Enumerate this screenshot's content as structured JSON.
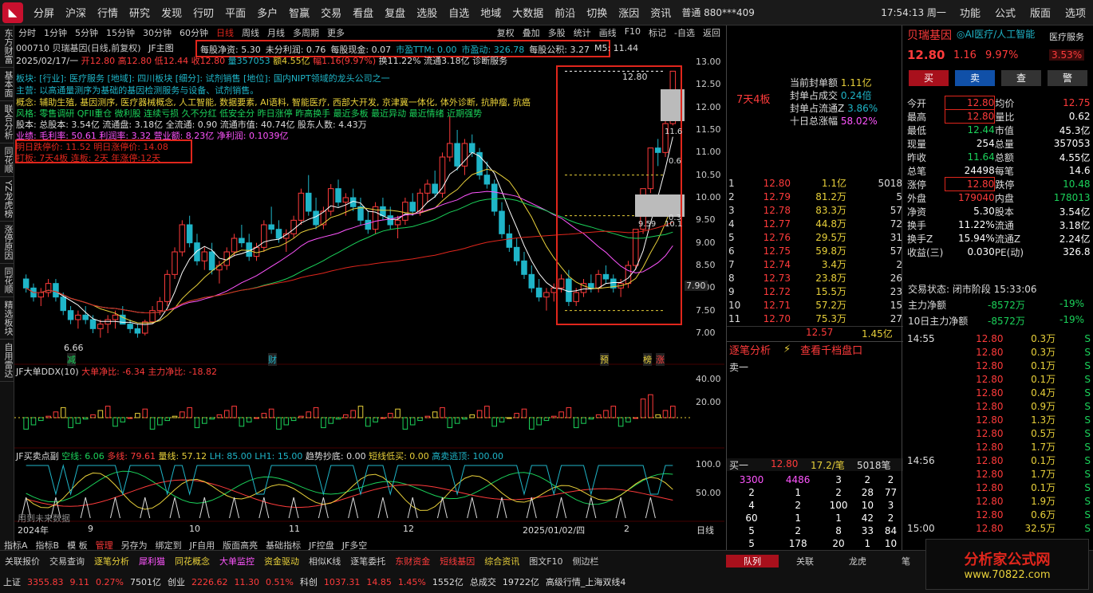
{
  "topbar": {
    "logo": "◣",
    "menu": [
      "分屏",
      "沪深",
      "行情",
      "研究",
      "发现",
      "行叨",
      "平面",
      "多户",
      "智赢",
      "交易",
      "看盘",
      "复盘",
      "选股",
      "自选",
      "地域",
      "大数据",
      "前沿",
      "切换",
      "涨因",
      "资讯"
    ],
    "account": "普通 880***409",
    "clock": "17:54:13 周一",
    "right_menu": [
      "功能",
      "公式",
      "版面",
      "选项"
    ]
  },
  "left_rail": [
    "东方财富",
    "基本面",
    "联合分析",
    "同花顺",
    "YZ龙虎榜",
    "涨停原因",
    "同花顺",
    "精选板块",
    "自用雷达"
  ],
  "toolbar": {
    "periods": [
      "分时",
      "1分钟",
      "5分钟",
      "15分钟",
      "30分钟",
      "60分钟",
      "日线",
      "周线",
      "月线",
      "多周期",
      "更多"
    ],
    "right": [
      "复权",
      "叠加",
      "多股",
      "统计",
      "画线",
      "F10",
      "标记",
      "-自选",
      "返回"
    ]
  },
  "chart_header": {
    "code_title": "000710 贝瑞基因(日线,前复权)",
    "indicator": "JF主图",
    "date": "2025/02/17/一",
    "open": "开12.80",
    "high": "高12.80",
    "low": "低12.44",
    "close": "收12.80",
    "vol": "量357053",
    "amount": "额4.55亿",
    "change": "幅1.16(9.97%)",
    "turnover": "换11.22%",
    "float": "流通3.18亿",
    "tag": "诊断服务"
  },
  "fin": {
    "a": "每股净资: 5.30",
    "b": "未分利润: 0.76",
    "c": "每股现金: 0.07",
    "d": "市盈TTM: 0.00",
    "e": "市盈动: 326.78",
    "f": "每股公积: 3.27",
    "g": "M5: 11.44"
  },
  "info": {
    "l1": "板块: [行业]: 医疗服务 [地域]: 四川板块 [细分]: 试剂销售 [地位]: 国内NIPT领域的龙头公司之一",
    "l2": "主营: 以高通量测序为基础的基因检测服务与设备、试剂销售。",
    "l3": "概念: 辅助生殖, 基因测序, 医疗器械概念, 人工智能, 数据要素, AI语料, 智能医疗, 西部大开发, 京津冀一体化, 体外诊断, 抗肿瘤, 抗癌",
    "l4": "风格: 零售调研 QFII重仓 微利股 连续亏损 久不分红 低安全分 昨日涨停 昨高换手 最近多板 最近异动 最近情绪 近期强势",
    "l5": "股本: 总股本: 3.54亿 流通盘: 3.18亿 全流通: 0.90 流通市值: 40.74亿 股东人数: 4.43万",
    "l6": "业绩: 毛利率: 50.61 利润率: 3.32 营业额: 8.23亿 净利润: 0.1039亿",
    "l7": "明日跌停价: 11.52 明日涨停价: 14.08",
    "l8": "打板: 7天4板 连板: 2天 年涨停:12天"
  },
  "chart_data": {
    "type": "candlestick",
    "yaxis": [
      "13.00",
      "12.50",
      "12.00",
      "11.50",
      "11.00",
      "10.50",
      "10.00",
      "9.50",
      "9.00",
      "8.50",
      "8.00",
      "7.90",
      "7.50",
      "7.00"
    ],
    "ylim": [
      7.0,
      13.0
    ],
    "xlabels": [
      "2024年",
      "9",
      "10",
      "11",
      "12",
      "2025/01/02/四",
      "2",
      "日线"
    ],
    "low_mark": "6.66",
    "last_price": "12.80",
    "marks": [
      "减",
      "财",
      "预",
      "榜",
      "涨"
    ],
    "panel_tags": [
      "11.6",
      "10.1",
      "9.59",
      "0.6",
      "0.3"
    ],
    "board_label": "7天4板",
    "sealing": {
      "title1": "当前封单额",
      "v1": "1.11亿",
      "title2": "封单占成交",
      "v2": "0.24倍",
      "title3": "封单占流通Z",
      "v3": "3.86%",
      "title4": "十日总涨幅",
      "v4": "58.02%"
    },
    "ohlc": [
      [
        8.2,
        8.3,
        7.9,
        8.0
      ],
      [
        8.0,
        8.1,
        7.7,
        7.8
      ],
      [
        7.8,
        8.0,
        7.6,
        7.9
      ],
      [
        7.9,
        8.2,
        7.8,
        8.1
      ],
      [
        8.1,
        8.2,
        7.7,
        7.8
      ],
      [
        7.8,
        7.9,
        7.4,
        7.5
      ],
      [
        7.5,
        7.6,
        7.2,
        7.3
      ],
      [
        7.3,
        7.5,
        7.1,
        7.4
      ],
      [
        7.4,
        7.6,
        7.2,
        7.3
      ],
      [
        7.3,
        7.4,
        7.0,
        7.1
      ],
      [
        7.1,
        7.3,
        6.9,
        7.2
      ],
      [
        7.2,
        7.4,
        7.0,
        7.3
      ],
      [
        7.3,
        7.5,
        7.1,
        7.4
      ],
      [
        7.4,
        7.6,
        7.2,
        7.2
      ],
      [
        7.2,
        7.3,
        7.0,
        7.1
      ],
      [
        7.1,
        7.2,
        6.9,
        7.0
      ],
      [
        7.0,
        7.3,
        6.95,
        7.25
      ],
      [
        7.25,
        7.6,
        7.2,
        7.5
      ],
      [
        7.5,
        7.8,
        7.4,
        7.7
      ],
      [
        7.7,
        8.4,
        7.6,
        8.3
      ],
      [
        8.3,
        8.9,
        8.2,
        8.8
      ],
      [
        8.8,
        9.5,
        8.7,
        9.4
      ],
      [
        9.4,
        9.6,
        8.9,
        9.0
      ],
      [
        9.0,
        9.2,
        8.5,
        8.6
      ],
      [
        8.6,
        8.9,
        8.4,
        8.8
      ],
      [
        8.8,
        9.0,
        8.3,
        8.4
      ],
      [
        8.4,
        8.6,
        8.1,
        8.5
      ],
      [
        8.5,
        8.9,
        8.4,
        8.8
      ],
      [
        8.8,
        9.2,
        8.7,
        9.1
      ],
      [
        9.1,
        9.4,
        8.9,
        9.0
      ],
      [
        9.0,
        9.2,
        8.6,
        8.7
      ],
      [
        8.7,
        9.0,
        8.6,
        8.9
      ],
      [
        8.9,
        9.5,
        8.8,
        9.4
      ],
      [
        9.4,
        9.8,
        9.2,
        9.3
      ],
      [
        9.3,
        9.5,
        9.0,
        9.1
      ],
      [
        9.1,
        9.3,
        8.8,
        9.2
      ],
      [
        9.2,
        9.6,
        9.1,
        9.5
      ],
      [
        9.5,
        10.2,
        9.4,
        10.1
      ],
      [
        10.1,
        10.5,
        9.6,
        9.7
      ],
      [
        9.7,
        10.0,
        9.3,
        9.4
      ],
      [
        9.4,
        9.8,
        9.3,
        9.7
      ],
      [
        9.7,
        10.3,
        9.6,
        10.2
      ],
      [
        10.2,
        10.4,
        9.8,
        9.9
      ],
      [
        9.9,
        10.1,
        9.6,
        10.0
      ],
      [
        10.0,
        10.2,
        9.7,
        9.8
      ],
      [
        9.8,
        10.0,
        9.4,
        9.5
      ],
      [
        9.5,
        9.7,
        9.2,
        9.3
      ],
      [
        9.3,
        9.9,
        9.2,
        9.8
      ],
      [
        9.8,
        10.0,
        9.5,
        9.6
      ],
      [
        9.6,
        9.8,
        9.3,
        9.4
      ],
      [
        9.4,
        9.6,
        9.1,
        9.5
      ],
      [
        9.5,
        10.0,
        9.4,
        9.9
      ],
      [
        9.9,
        10.1,
        9.6,
        9.7
      ],
      [
        9.7,
        10.2,
        9.6,
        10.1
      ],
      [
        10.1,
        10.4,
        9.9,
        10.3
      ],
      [
        10.3,
        10.6,
        10.0,
        10.1
      ],
      [
        10.1,
        11.0,
        10.0,
        10.9
      ],
      [
        10.9,
        11.8,
        10.8,
        11.2
      ],
      [
        11.2,
        11.5,
        10.6,
        10.7
      ],
      [
        10.7,
        11.3,
        10.5,
        11.2
      ],
      [
        11.2,
        11.4,
        10.9,
        11.0
      ],
      [
        11.0,
        11.1,
        10.4,
        10.5
      ],
      [
        10.5,
        10.8,
        10.2,
        10.3
      ],
      [
        10.3,
        10.4,
        9.6,
        9.7
      ],
      [
        9.7,
        9.9,
        9.1,
        9.2
      ],
      [
        9.2,
        9.4,
        8.8,
        8.9
      ],
      [
        8.9,
        9.1,
        8.5,
        8.6
      ],
      [
        8.6,
        8.8,
        8.2,
        8.3
      ],
      [
        8.3,
        8.5,
        7.9,
        8.0
      ],
      [
        8.0,
        8.2,
        7.7,
        7.8
      ],
      [
        7.8,
        8.0,
        7.5,
        7.9
      ],
      [
        7.9,
        8.1,
        7.7,
        8.0
      ],
      [
        8.0,
        8.3,
        7.9,
        8.2
      ],
      [
        8.2,
        8.4,
        7.6,
        7.7
      ],
      [
        7.7,
        8.0,
        7.6,
        7.9
      ],
      [
        7.9,
        8.2,
        7.8,
        8.1
      ],
      [
        8.1,
        8.3,
        7.9,
        8.0
      ],
      [
        8.0,
        8.4,
        7.9,
        8.3
      ],
      [
        8.3,
        8.5,
        8.1,
        8.2
      ],
      [
        8.2,
        8.3,
        7.9,
        8.0
      ],
      [
        8.0,
        8.2,
        7.8,
        8.1
      ],
      [
        8.1,
        8.6,
        8.0,
        8.5
      ],
      [
        8.5,
        9.3,
        8.4,
        9.3
      ],
      [
        9.3,
        10.2,
        9.2,
        10.2
      ],
      [
        10.2,
        11.1,
        10.1,
        11.1
      ],
      [
        11.1,
        11.3,
        10.7,
        11.0
      ],
      [
        11.0,
        11.7,
        10.9,
        11.64
      ],
      [
        11.64,
        12.8,
        11.6,
        12.8
      ]
    ],
    "ddx_axis": [
      "40.00",
      "20.00"
    ],
    "ddx_title": "JF大单DDX(10)",
    "ddx_a": "大单净比: -6.34",
    "ddx_b": "主力净比: -18.82",
    "bs_axis": [
      "100.0",
      "50.00"
    ],
    "bs_title": "JF买卖点副",
    "bs_a": "空线: 6.06",
    "bs_b": "多线: 79.61",
    "bs_c": "量线: 57.12",
    "bs_d": "LH: 85.00",
    "bs_e": "LH1: 15.00",
    "bs_f": "趋势抄底: 0.00",
    "bs_g": "短线低买: 0.00",
    "bs_h": "高卖逃顶: 100.00",
    "bs_tip": "用到未来数据"
  },
  "quote": {
    "name": "贝瑞基因",
    "concept": "◎AI医疗/人工智能",
    "industry": "医疗服务",
    "price": "12.80",
    "chg": "1.16",
    "pct": "9.97%",
    "ind_pct": "3.53%",
    "btns": [
      "买",
      "卖",
      "查",
      "警"
    ],
    "rows": [
      [
        "今开",
        "12.80",
        "均价",
        "12.75"
      ],
      [
        "最高",
        "12.80",
        "量比",
        "0.62"
      ],
      [
        "最低",
        "12.44",
        "市值",
        "45.3亿"
      ],
      [
        "现量",
        "254",
        "总量",
        "357053"
      ],
      [
        "昨收",
        "11.64",
        "总额",
        "4.55亿"
      ],
      [
        "总笔",
        "24498",
        "每笔",
        "14.6"
      ],
      [
        "涨停",
        "12.80",
        "跌停",
        "10.48"
      ],
      [
        "外盘",
        "179040",
        "内盘",
        "178013"
      ],
      [
        "净资",
        "5.30",
        "股本",
        "3.54亿"
      ],
      [
        "换手",
        "11.22%",
        "流通",
        "3.18亿"
      ],
      [
        "换手Z",
        "15.94%",
        "流通Z",
        "2.24亿"
      ],
      [
        "收益(三)",
        "0.030",
        "PE(动)",
        "326.8"
      ]
    ],
    "status": "交易状态: 闭市阶段 15:33:06",
    "main_net": "主力净额",
    "main_net_v": "-8572万",
    "main_net_p": "-19%",
    "ten_net": "10日主力净额",
    "ten_net_v": "-8572万",
    "ten_net_p": "-19%"
  },
  "order_book": [
    [
      "1",
      "12.80",
      "1.1亿",
      "5018"
    ],
    [
      "2",
      "12.79",
      "81.2万",
      "5"
    ],
    [
      "3",
      "12.78",
      "83.3万",
      "57"
    ],
    [
      "4",
      "12.77",
      "44.8万",
      "72"
    ],
    [
      "5",
      "12.76",
      "29.5万",
      "31"
    ],
    [
      "6",
      "12.75",
      "59.8万",
      "57"
    ],
    [
      "7",
      "12.74",
      "3.4万",
      "2"
    ],
    [
      "8",
      "12.73",
      "23.8万",
      "26"
    ],
    [
      "9",
      "12.72",
      "15.5万",
      "23"
    ],
    [
      "10",
      "12.71",
      "57.2万",
      "15"
    ],
    [
      "11",
      "12.70",
      "75.3万",
      "27"
    ]
  ],
  "ob_foot": [
    "12.57",
    "1.45亿"
  ],
  "tick_tabs": [
    "逐笔分析",
    "查看千档盘口"
  ],
  "sell1": "卖一",
  "buy1": [
    "买一",
    "12.80",
    "17.2/笔",
    "5018笔"
  ],
  "queue": [
    [
      "3300",
      "4486",
      "3",
      "2",
      "2"
    ],
    [
      "2",
      "1",
      "2",
      "28",
      "77"
    ],
    [
      "4",
      "2",
      "100",
      "10",
      "3"
    ],
    [
      "60",
      "1",
      "1",
      "42",
      "2"
    ],
    [
      "5",
      "2",
      "8",
      "33",
      "84"
    ],
    [
      "5",
      "178",
      "20",
      "1",
      "10"
    ]
  ],
  "ticks": [
    [
      "14:55",
      "12.80",
      "0.3万",
      "S"
    ],
    [
      "",
      "12.80",
      "0.3万",
      "S"
    ],
    [
      "",
      "12.80",
      "0.1万",
      "S"
    ],
    [
      "",
      "12.80",
      "0.1万",
      "S"
    ],
    [
      "",
      "12.80",
      "0.4万",
      "S"
    ],
    [
      "",
      "12.80",
      "0.9万",
      "S"
    ],
    [
      "",
      "12.80",
      "1.3万",
      "S"
    ],
    [
      "",
      "12.80",
      "0.5万",
      "S"
    ],
    [
      "",
      "12.80",
      "1.7万",
      "S"
    ],
    [
      "14:56",
      "12.80",
      "0.1万",
      "S"
    ],
    [
      "",
      "12.80",
      "1.7万",
      "S"
    ],
    [
      "",
      "12.80",
      "0.1万",
      "S"
    ],
    [
      "",
      "12.80",
      "1.9万",
      "S"
    ],
    [
      "",
      "12.80",
      "0.6万",
      "S"
    ],
    [
      "15:00",
      "12.80",
      "32.5万",
      "S"
    ]
  ],
  "bottom": {
    "row1": [
      "指标A",
      "指标B",
      "模 板",
      "管理",
      "另存为",
      "绑定到",
      "JF自用",
      "版面高亮",
      "基础指标",
      "JF控盘",
      "JF多空"
    ],
    "row2": [
      "关联报价",
      "交易查询",
      "逐笔分析",
      "犀利猫",
      "同花概念",
      "大单监控",
      "资金驱动",
      "相似K线",
      "逐笔委托",
      "东财资金",
      "短线基因",
      "综合资讯",
      "图文F10",
      "侧边栏"
    ],
    "row2_right": [
      "队列",
      "关联",
      "龙虎",
      "笔"
    ],
    "index": [
      "上证",
      "3355.83",
      "9.11",
      "0.27%",
      "7501亿",
      "创业",
      "2226.62",
      "11.30",
      "0.51%",
      "科创",
      "1037.31",
      "14.85",
      "1.45%",
      "1552亿",
      "总成交",
      "19722亿",
      "高级行情_上海双线4"
    ]
  },
  "brand": {
    "t1": "分析家公式网",
    "t2": "www.70822.com"
  }
}
